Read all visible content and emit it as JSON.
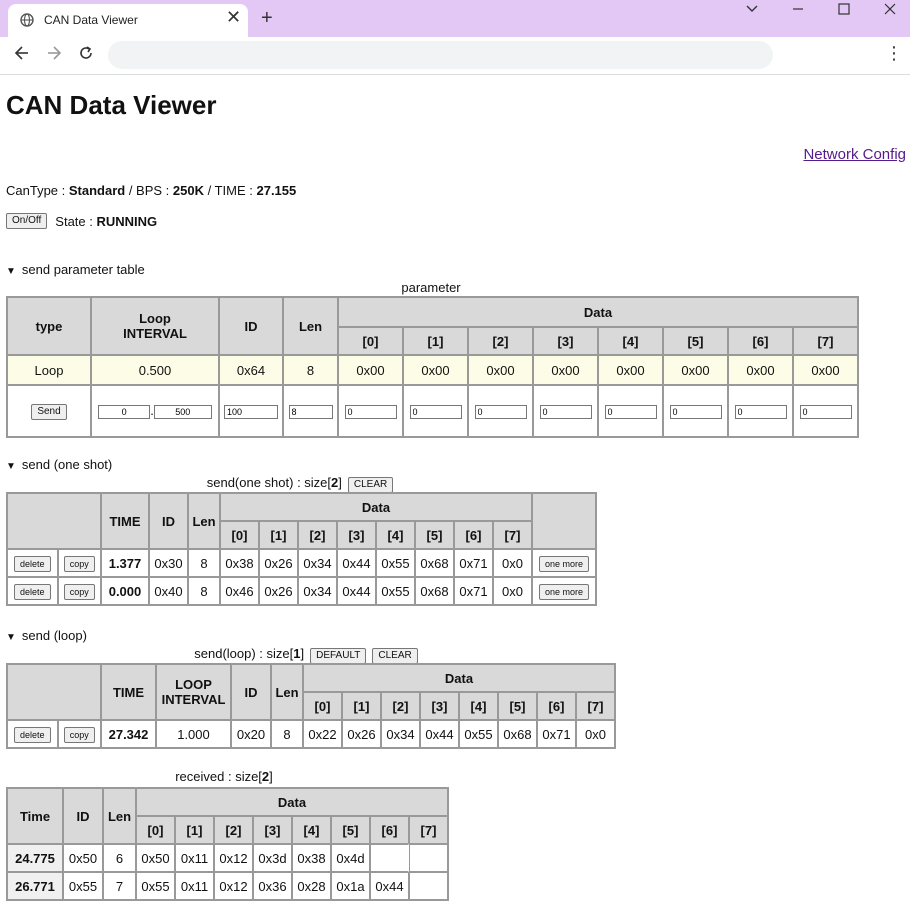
{
  "browser": {
    "tab_title": "CAN Data Viewer",
    "new_tab": "+",
    "close_tab": "✕"
  },
  "page": {
    "title": "CAN Data Viewer",
    "network_link": "Network Config",
    "status": {
      "cantype_label": "CanType : ",
      "cantype": "Standard",
      "bps_label": " / BPS : ",
      "bps": "250K",
      "time_label": " / TIME : ",
      "time": "27.155"
    },
    "onoff_button": "On/Off",
    "state_label": "State : ",
    "state": "RUNNING"
  },
  "param_section": {
    "summary": "send parameter table",
    "caption": "parameter",
    "headers": {
      "type": "type",
      "loop_line1": "Loop",
      "loop_line2": "INTERVAL",
      "id": "ID",
      "len": "Len",
      "data": "Data",
      "idx": [
        "[0]",
        "[1]",
        "[2]",
        "[3]",
        "[4]",
        "[5]",
        "[6]",
        "[7]"
      ]
    },
    "row": {
      "type": "Loop",
      "interval": "0.500",
      "id": "0x64",
      "len": "8",
      "data": [
        "0x00",
        "0x00",
        "0x00",
        "0x00",
        "0x00",
        "0x00",
        "0x00",
        "0x00"
      ]
    },
    "inputs": {
      "send_button": "Send",
      "interval_int": "0",
      "interval_sep": ".",
      "interval_frac": "500",
      "id": "100",
      "len": "8",
      "data": [
        "0",
        "0",
        "0",
        "0",
        "0",
        "0",
        "0",
        "0"
      ]
    }
  },
  "oneshot_section": {
    "summary": "send (one shot)",
    "caption_prefix": "send(one shot) : size[",
    "size": "2",
    "caption_suffix": "]",
    "clear_button": "CLEAR",
    "headers": {
      "time": "TIME",
      "id": "ID",
      "len": "Len",
      "data": "Data",
      "idx": [
        "[0]",
        "[1]",
        "[2]",
        "[3]",
        "[4]",
        "[5]",
        "[6]",
        "[7]"
      ]
    },
    "rows": [
      {
        "delete": "delete",
        "copy": "copy",
        "time": "1.377",
        "id": "0x30",
        "len": "8",
        "data": [
          "0x38",
          "0x26",
          "0x34",
          "0x44",
          "0x55",
          "0x68",
          "0x71",
          "0x0"
        ],
        "more": "one more"
      },
      {
        "delete": "delete",
        "copy": "copy",
        "time": "0.000",
        "id": "0x40",
        "len": "8",
        "data": [
          "0x46",
          "0x26",
          "0x34",
          "0x44",
          "0x55",
          "0x68",
          "0x71",
          "0x0"
        ],
        "more": "one more"
      }
    ]
  },
  "loop_section": {
    "summary": "send (loop)",
    "caption_prefix": "send(loop) : size[",
    "size": "1",
    "caption_suffix": "]",
    "default_button": "DEFAULT",
    "clear_button": "CLEAR",
    "headers": {
      "time": "TIME",
      "loop_line1": "LOOP",
      "loop_line2": "INTERVAL",
      "id": "ID",
      "len": "Len",
      "data": "Data",
      "idx": [
        "[0]",
        "[1]",
        "[2]",
        "[3]",
        "[4]",
        "[5]",
        "[6]",
        "[7]"
      ]
    },
    "rows": [
      {
        "delete": "delete",
        "copy": "copy",
        "time": "27.342",
        "interval": "1.000",
        "id": "0x20",
        "len": "8",
        "data": [
          "0x22",
          "0x26",
          "0x34",
          "0x44",
          "0x55",
          "0x68",
          "0x71",
          "0x0"
        ]
      }
    ]
  },
  "received_section": {
    "caption_prefix": "received : size[",
    "size": "2",
    "caption_suffix": "]",
    "headers": {
      "time": "Time",
      "id": "ID",
      "len": "Len",
      "data": "Data",
      "idx": [
        "[0]",
        "[1]",
        "[2]",
        "[3]",
        "[4]",
        "[5]",
        "[6]",
        "[7]"
      ]
    },
    "rows": [
      {
        "time": "24.775",
        "id": "0x50",
        "len": "6",
        "data": [
          "0x50",
          "0x11",
          "0x12",
          "0x3d",
          "0x38",
          "0x4d",
          "",
          ""
        ]
      },
      {
        "time": "26.771",
        "id": "0x55",
        "len": "7",
        "data": [
          "0x55",
          "0x11",
          "0x12",
          "0x36",
          "0x28",
          "0x1a",
          "0x44",
          ""
        ]
      }
    ]
  }
}
